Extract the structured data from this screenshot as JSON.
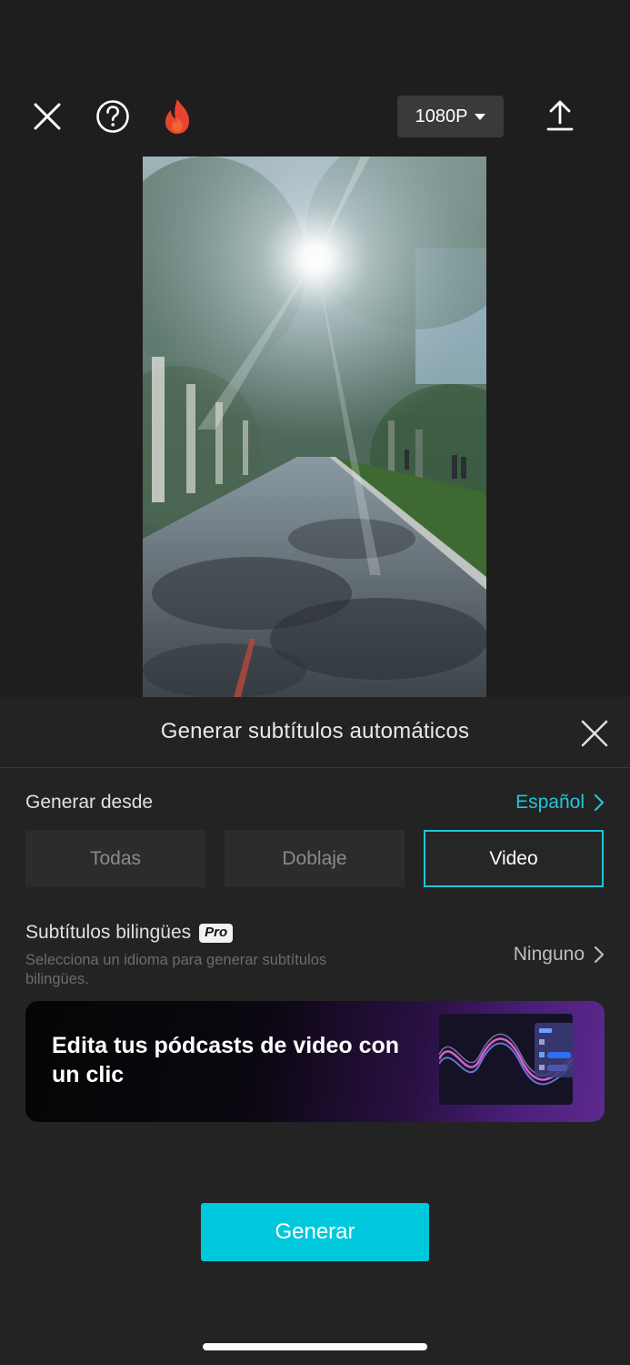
{
  "toolbar": {
    "close_icon": "close-icon",
    "help_icon": "help-icon",
    "fire_icon": "fire-icon",
    "resolution_label": "1080P",
    "export_icon": "upload-icon"
  },
  "preview": {
    "subject": "sunlit tree-lined path"
  },
  "subtitle_sheet": {
    "title": "Generar subtítulos automáticos",
    "generate_from": {
      "label": "Generar desde",
      "language": "Español"
    },
    "source_options": [
      {
        "label": "Todas",
        "selected": false
      },
      {
        "label": "Doblaje",
        "selected": false
      },
      {
        "label": "Video",
        "selected": true
      }
    ],
    "bilingual": {
      "title": "Subtítulos bilingües",
      "badge": "Pro",
      "description": "Selecciona un idioma para generar subtítulos bilingües.",
      "value": "Ninguno"
    },
    "promo_banner": {
      "text": "Edita tus pódcasts de video con un clic"
    },
    "generate_button": "Generar"
  },
  "colors": {
    "accent": "#1fc6dc",
    "button": "#00c8dc",
    "background": "#1e1e1e",
    "sheet": "#232323"
  }
}
